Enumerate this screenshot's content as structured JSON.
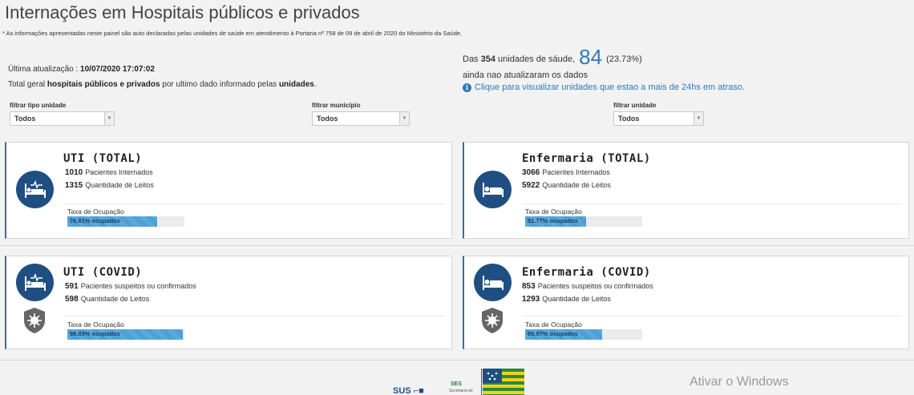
{
  "header": {
    "title": "Internações em Hospitais públicos e privados",
    "note": "* As informações apresentadas neste painel são auto declaradas pelas unidades de saúde em atendimento à Portaria nº 758 de 09 de abril de 2020 do Ministério da Saúde."
  },
  "update": {
    "label": "Última atualização : ",
    "value": "10/07/2020 17:07:02",
    "total_pre": "Total geral ",
    "total_bold": "hospitais públicos e privados",
    "total_mid": " por ultimo dado informado pelas ",
    "total_bold2": "unidades",
    "total_end": "."
  },
  "units": {
    "pre": "Das ",
    "total": "354",
    "mid": " unidades de sáude, ",
    "late": "84",
    "pct": " (23.73%)",
    "line2": "ainda nao atualizaram os dados",
    "info_icon": "info-circle-icon",
    "link": "Clique para visualizar unidades que estao a mais de 24hs em atraso."
  },
  "filters": [
    {
      "label": "filtrar tipo unidade",
      "value": "Todos"
    },
    {
      "label": "filtrar município",
      "value": "Todos"
    },
    {
      "label": "filtrar unidade",
      "value": "Todos"
    }
  ],
  "cards": {
    "uti_total": {
      "title": "UTI (TOTAL)",
      "patients": "1010",
      "patients_label": "Pacientes Internados",
      "beds": "1315",
      "beds_label": "Quantidade de Leitos",
      "taxa_label": "Taxa de Ocupação",
      "occupancy_pct": 76.81,
      "occupancy_text": "76.81% ocupados",
      "icon": "icu-bed-icon"
    },
    "enf_total": {
      "title": "Enfermaria (TOTAL)",
      "patients": "3066",
      "patients_label": "Pacientes Internados",
      "beds": "5922",
      "beds_label": "Quantidade de Leitos",
      "taxa_label": "Taxa de Ocupação",
      "occupancy_pct": 51.77,
      "occupancy_text": "51.77% ocupados",
      "icon": "bed-icon"
    },
    "uti_covid": {
      "title": "UTI (COVID)",
      "patients": "591",
      "patients_label": "Pacientes suspeitos ou confirmados",
      "beds": "598",
      "beds_label": "Quantidade de Leitos",
      "taxa_label": "Taxa de Ocupação",
      "occupancy_pct": 98.83,
      "occupancy_text": "98.83% ocupados",
      "icon": "icu-bed-icon"
    },
    "enf_covid": {
      "title": "Enfermaria (COVID)",
      "patients": "853",
      "patients_label": "Pacientes suspeitos ou confirmados",
      "beds": "1293",
      "beds_label": "Quantidade de Leitos",
      "taxa_label": "Taxa de Ocupação",
      "occupancy_pct": 65.97,
      "occupancy_text": "65.97% ocupados",
      "icon": "bed-icon"
    }
  },
  "footer": {
    "sus": "SUS",
    "ses": "SES",
    "ses_sub": "Secretaria de",
    "watermark": "Ativar o Windows"
  },
  "colors": {
    "accent": "#2e7ab8",
    "icon_bg": "#1f4f82",
    "bar_fill": "#5ba9dc"
  }
}
